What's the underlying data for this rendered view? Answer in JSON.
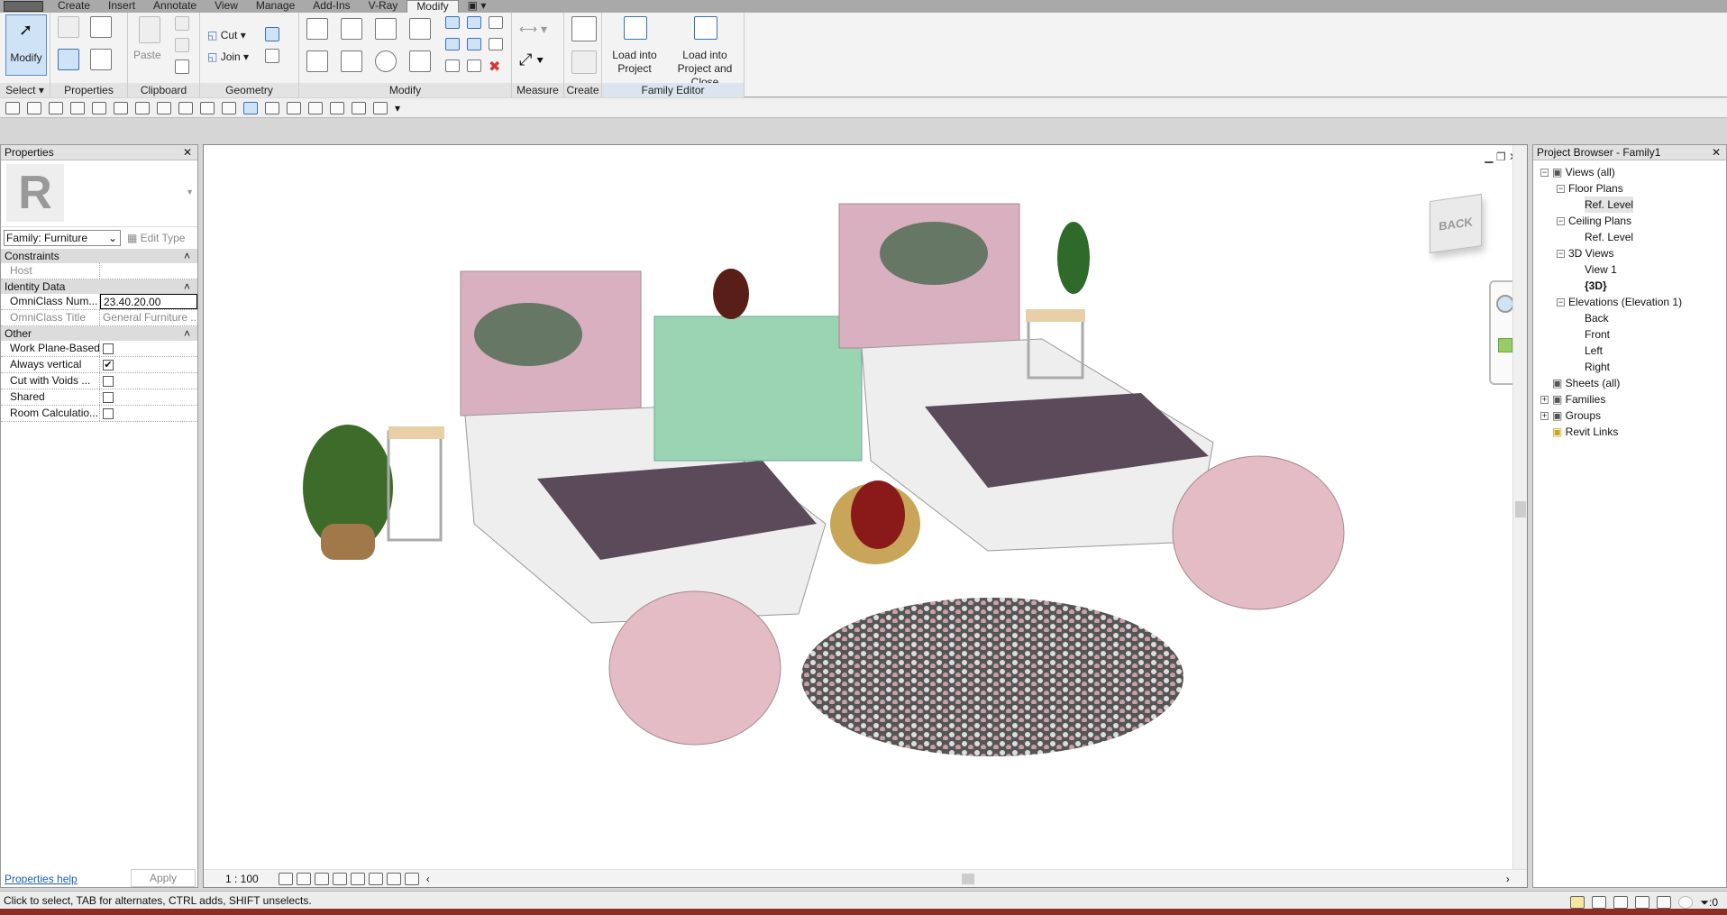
{
  "menu": {
    "tabs": [
      "Create",
      "Insert",
      "Annotate",
      "View",
      "Manage",
      "Add-Ins",
      "V-Ray",
      "Modify"
    ],
    "active": "Modify"
  },
  "ribbon": {
    "select": {
      "label": "Select ▾",
      "modify": "Modify"
    },
    "properties": {
      "label": "Properties"
    },
    "clipboard": {
      "label": "Clipboard",
      "paste": "Paste"
    },
    "geometry": {
      "label": "Geometry",
      "cut": "Cut",
      "join": "Join"
    },
    "modify": {
      "label": "Modify"
    },
    "measure": {
      "label": "Measure"
    },
    "create": {
      "label": "Create"
    },
    "family_editor": {
      "label": "Family Editor",
      "load": "Load into Project",
      "load_close": "Load into Project and Close"
    }
  },
  "properties": {
    "title": "Properties",
    "type_selector": "Family: Furniture",
    "edit_type": "Edit Type",
    "sections": [
      {
        "name": "Constraints",
        "rows": [
          {
            "k": "Host",
            "v": "",
            "grey": true
          }
        ]
      },
      {
        "name": "Identity Data",
        "rows": [
          {
            "k": "OmniClass Num...",
            "v": "23.40.20.00"
          },
          {
            "k": "OmniClass Title",
            "v": "General Furniture ...",
            "grey": true
          }
        ]
      },
      {
        "name": "Other",
        "rows": [
          {
            "k": "Work Plane-Based",
            "check": false
          },
          {
            "k": "Always vertical",
            "check": true
          },
          {
            "k": "Cut with Voids ...",
            "check": false
          },
          {
            "k": "Shared",
            "check": false
          },
          {
            "k": "Room Calculatio...",
            "check": false
          }
        ]
      }
    ],
    "help": "Properties help",
    "apply": "Apply"
  },
  "view": {
    "scale": "1 : 100",
    "viewcube_face": "BACK"
  },
  "browser": {
    "title": "Project Browser - Family1",
    "items": [
      {
        "label": "Views (all)",
        "level": 0,
        "toggle": "−"
      },
      {
        "label": "Floor Plans",
        "level": 1,
        "toggle": "−"
      },
      {
        "label": "Ref. Level",
        "level": 2,
        "selected": true
      },
      {
        "label": "Ceiling Plans",
        "level": 1,
        "toggle": "−"
      },
      {
        "label": "Ref. Level",
        "level": 2
      },
      {
        "label": "3D Views",
        "level": 1,
        "toggle": "−"
      },
      {
        "label": "View 1",
        "level": 2
      },
      {
        "label": "{3D}",
        "level": 2,
        "bold": true
      },
      {
        "label": "Elevations (Elevation 1)",
        "level": 1,
        "toggle": "−"
      },
      {
        "label": "Back",
        "level": 2
      },
      {
        "label": "Front",
        "level": 2
      },
      {
        "label": "Left",
        "level": 2
      },
      {
        "label": "Right",
        "level": 2
      },
      {
        "label": "Sheets (all)",
        "level": 0
      },
      {
        "label": "Families",
        "level": 0,
        "toggle": "+"
      },
      {
        "label": "Groups",
        "level": 0,
        "toggle": "+"
      },
      {
        "label": "Revit Links",
        "level": 0
      }
    ]
  },
  "status": {
    "message": "Click to select, TAB for alternates, CTRL adds, SHIFT unselects.",
    "filter_count": ":0"
  }
}
